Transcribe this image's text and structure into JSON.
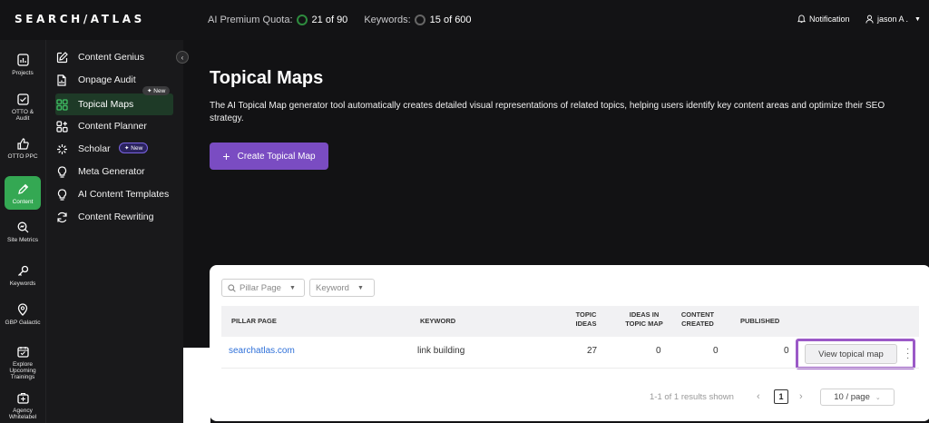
{
  "brand": {
    "logo": "SEARCH/ATLAS"
  },
  "header": {
    "quota_label": "AI Premium Quota:",
    "quota_value": "21 of 90",
    "keywords_label": "Keywords:",
    "keywords_value": "15 of 600",
    "notification": "Notification",
    "user": "jason A ."
  },
  "rail": [
    {
      "label": "Projects",
      "icon": "projects-icon"
    },
    {
      "label": "OTTO & Audit",
      "icon": "otto-audit-icon"
    },
    {
      "label": "OTTO PPC",
      "icon": "thumbs-up-icon"
    },
    {
      "label": "Content",
      "icon": "pencil-icon",
      "active": true
    },
    {
      "label": "Site Metrics",
      "icon": "site-metrics-icon"
    },
    {
      "label": "Keywords",
      "icon": "key-icon"
    },
    {
      "label": "GBP Galactic",
      "icon": "location-pin-icon"
    },
    {
      "label": "Explore Upcoming Trainings",
      "icon": "calendar-icon"
    },
    {
      "label": "Agency Whitelabel",
      "icon": "agency-icon"
    }
  ],
  "menu": [
    {
      "label": "Content Genius",
      "icon": "edit-icon"
    },
    {
      "label": "Onpage Audit",
      "icon": "document-chart-icon"
    },
    {
      "label": "Topical Maps",
      "icon": "grid-icon",
      "active": true,
      "badge": "New"
    },
    {
      "label": "Content Planner",
      "icon": "planner-icon"
    },
    {
      "label": "Scholar",
      "icon": "sparkle-icon",
      "badge": "New"
    },
    {
      "label": "Meta Generator",
      "icon": "lightbulb-icon"
    },
    {
      "label": "AI Content Templates",
      "icon": "lightbulb-icon"
    },
    {
      "label": "Content Rewriting",
      "icon": "refresh-icon"
    }
  ],
  "main": {
    "title": "Topical Maps",
    "description": "The AI Topical Map generator tool automatically creates detailed visual representations of related topics, helping users identify key content areas and optimize their SEO strategy.",
    "create_button": "Create Topical Map"
  },
  "table": {
    "filters": {
      "pillar_placeholder": "Pillar Page",
      "keyword_placeholder": "Keyword"
    },
    "columns": {
      "pillar_page": "PILLAR PAGE",
      "keyword": "KEYWORD",
      "topic_ideas_1": "TOPIC",
      "topic_ideas_2": "IDEAS",
      "ideas_in_map_1": "IDEAS IN",
      "ideas_in_map_2": "TOPIC MAP",
      "content_created_1": "CONTENT",
      "content_created_2": "CREATED",
      "published": "PUBLISHED"
    },
    "rows": [
      {
        "pillar_page": "searchatlas.com",
        "keyword": "link building",
        "topic_ideas": "27",
        "ideas_in_map": "0",
        "content_created": "0",
        "published": "0",
        "action": "View topical map"
      }
    ],
    "pagination": {
      "summary": "1-1 of 1 results shown",
      "current_page": "1",
      "page_size": "10 / page"
    }
  }
}
